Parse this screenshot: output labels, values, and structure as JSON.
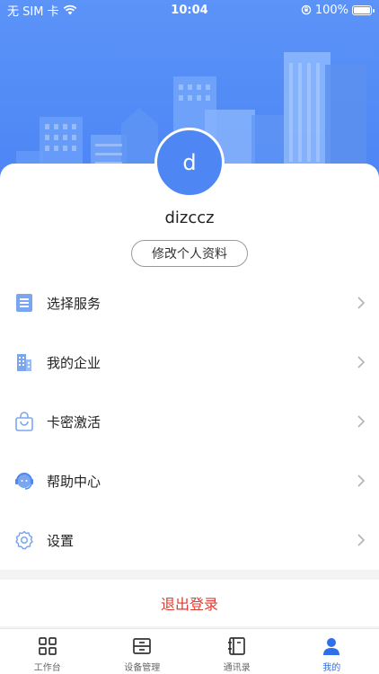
{
  "status_bar": {
    "carrier": "无 SIM 卡",
    "time": "10:04",
    "battery": "100%",
    "battery_level": 1.0
  },
  "profile": {
    "avatar_letter": "d",
    "username": "dizccz",
    "edit_button": "修改个人资料"
  },
  "menu": {
    "items": [
      {
        "label": "选择服务",
        "icon": "service-list-icon"
      },
      {
        "label": "我的企业",
        "icon": "building-icon"
      },
      {
        "label": "卡密激活",
        "icon": "shopping-bag-icon"
      },
      {
        "label": "帮助中心",
        "icon": "headset-icon"
      },
      {
        "label": "设置",
        "icon": "gear-icon"
      }
    ]
  },
  "logout": {
    "label": "退出登录"
  },
  "tabbar": {
    "tabs": [
      {
        "label": "工作台",
        "icon": "grid-icon",
        "active": false
      },
      {
        "label": "设备管理",
        "icon": "device-icon",
        "active": false
      },
      {
        "label": "通讯录",
        "icon": "contacts-book-icon",
        "active": false
      },
      {
        "label": "我的",
        "icon": "person-icon",
        "active": true
      }
    ]
  },
  "colors": {
    "accent": "#4e87f3",
    "header_blue": "#5b93f8",
    "logout_red": "#e23b2f",
    "active_tab": "#2f6fe8"
  }
}
